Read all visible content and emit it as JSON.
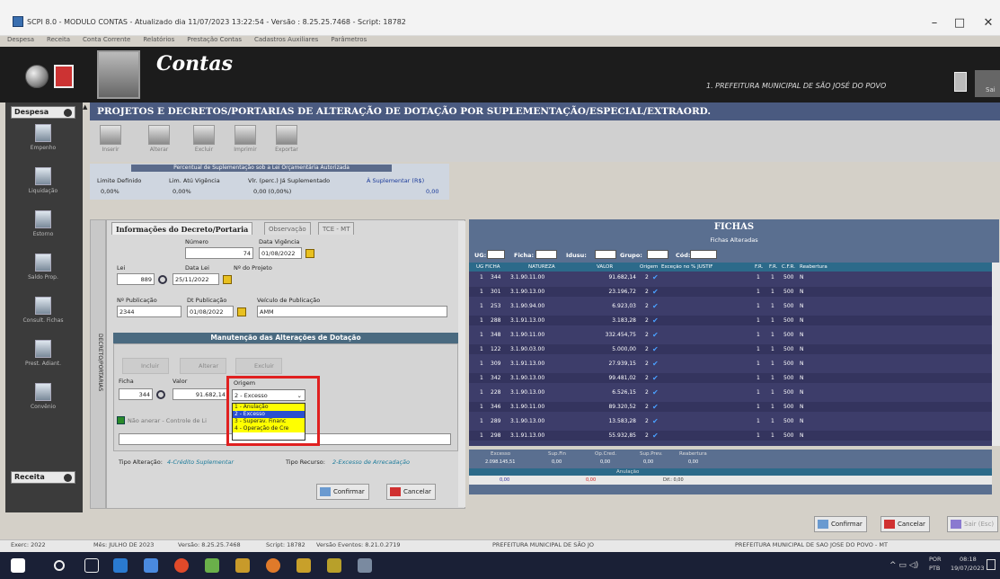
{
  "window": {
    "title": "SCPI 8.0 - MODULO CONTAS - Atualizado dia 11/07/2023 13:22:54 - Versão : 8.25.25.7468 - Script: 18782"
  },
  "menu": [
    "Despesa",
    "Receita",
    "Conta Corrente",
    "Relatórios",
    "Prestação Contas",
    "Cadastros Auxiliares",
    "Parâmetros"
  ],
  "header": {
    "app_name": "Contas",
    "prefeitura": "1. PREFEITURA MUNICIPAL DE SÃO JOSÉ DO POVO",
    "side_label": "Sai"
  },
  "nav": {
    "despesa_label": "Despesa",
    "receita_label": "Receita",
    "items": [
      "Empenho",
      "Liquidação",
      "Estorno",
      "Saldo Prop.",
      "Consult. Fichas",
      "Prest. Adiant.",
      "Convênio"
    ]
  },
  "page_title": "PROJETOS E DECRETOS/PORTARIAS DE ALTERAÇÃO DE DOTAÇÃO POR SUPLEMENTAÇÃO/ESPECIAL/EXTRAORD.",
  "toolbar": {
    "insert": "Inserir",
    "alter": "Alterar",
    "delete": "Excluir",
    "print": "Imprimir",
    "export": "Exportar"
  },
  "stats": {
    "title": "Percentual de Suplementação sob a Lei Orçamentária Autorizada",
    "limit_label": "Limite Definido",
    "limit_value": "0,00%",
    "lim_ativ_label": "Lim. Atú Vigência",
    "lim_ativ_value": "0,00%",
    "vlr_label": "Vlr. (perc.) Já Suplementado",
    "vlr_value": "0,00 (0,00%)",
    "a_sup_label": "À Suplementar (R$)",
    "a_sup_value": "0,00"
  },
  "form": {
    "side_label": "DECRETO/PORTARIAS",
    "tab_info": "Informações do Decreto/Portaria",
    "tab_obs": "Observação",
    "tab_tce": "TCE - MT",
    "numero_label": "Número",
    "numero_value": "74",
    "vigencia_label": "Data Vigência",
    "vigencia_value": "01/08/2022",
    "lei_label": "Lei",
    "lei_value": "889",
    "data_lei_label": "Data Lei",
    "data_lei_value": "25/11/2022",
    "nprojeto_label": "Nº do Projeto",
    "npub_label": "Nº Publicação",
    "npub_value": "2344",
    "dtpub_label": "Dt Publicação",
    "dtpub_value": "01/08/2022",
    "veiculo_label": "Veículo de Publicação",
    "veiculo_value": "AMM",
    "section_title": "Manutenção das Alterações de Dotação",
    "sub_incluir": "Incluir",
    "sub_alterar": "Alterar",
    "sub_excluir": "Excluir",
    "ficha_label": "Ficha",
    "ficha_value": "344",
    "valor_label": "Valor",
    "valor_value": "91.682,14",
    "origem_label": "Origem",
    "origem_selected": "2 - Excesso",
    "origem_options": [
      "1 - Anulação",
      "2 - Excesso",
      "3 - Superav. Financ",
      "4 - Operação de Cre"
    ],
    "checkbox_label": "Não anerar - Controle de Li",
    "tipo_alt_label": "Tipo Alteração:",
    "tipo_alt_value": "4-Crédito Suplementar",
    "tipo_rec_label": "Tipo Recurso:",
    "tipo_rec_value": "2-Excesso de Arrecadação",
    "confirm": "Confirmar",
    "cancel": "Cancelar"
  },
  "fichas": {
    "title": "FICHAS",
    "subtitle": "Fichas Alteradas",
    "filters": [
      "UG:",
      "Ficha:",
      "Idusu:",
      "Grupo:",
      "Cód:"
    ],
    "columns": [
      "UG",
      "FICHA",
      "NATUREZA",
      "VALOR",
      "Origem",
      "Exceção no % JUSTIF",
      "F.R.",
      "F.R.",
      "C.F.R.",
      "Reabertura"
    ],
    "rows": [
      {
        "ug": "1",
        "ficha": "344",
        "natureza": "3.1.90.11.00",
        "valor": "91.682,14",
        "origem": "2",
        "fr1": "1",
        "fr2": "1",
        "cfr": "500",
        "reab": "N"
      },
      {
        "ug": "1",
        "ficha": "301",
        "natureza": "3.1.90.13.00",
        "valor": "23.196,72",
        "origem": "2",
        "fr1": "1",
        "fr2": "1",
        "cfr": "500",
        "reab": "N"
      },
      {
        "ug": "1",
        "ficha": "253",
        "natureza": "3.1.90.94.00",
        "valor": "6.923,03",
        "origem": "2",
        "fr1": "1",
        "fr2": "1",
        "cfr": "500",
        "reab": "N"
      },
      {
        "ug": "1",
        "ficha": "288",
        "natureza": "3.1.91.13.00",
        "valor": "3.183,28",
        "origem": "2",
        "fr1": "1",
        "fr2": "1",
        "cfr": "500",
        "reab": "N"
      },
      {
        "ug": "1",
        "ficha": "348",
        "natureza": "3.1.90.11.00",
        "valor": "332.454,75",
        "origem": "2",
        "fr1": "1",
        "fr2": "1",
        "cfr": "500",
        "reab": "N"
      },
      {
        "ug": "1",
        "ficha": "122",
        "natureza": "3.1.90.03.00",
        "valor": "5.000,00",
        "origem": "2",
        "fr1": "1",
        "fr2": "1",
        "cfr": "500",
        "reab": "N"
      },
      {
        "ug": "1",
        "ficha": "309",
        "natureza": "3.1.91.13.00",
        "valor": "27.939,15",
        "origem": "2",
        "fr1": "1",
        "fr2": "1",
        "cfr": "500",
        "reab": "N"
      },
      {
        "ug": "1",
        "ficha": "342",
        "natureza": "3.1.90.13.00",
        "valor": "99.481,02",
        "origem": "2",
        "fr1": "1",
        "fr2": "1",
        "cfr": "500",
        "reab": "N"
      },
      {
        "ug": "1",
        "ficha": "228",
        "natureza": "3.1.90.13.00",
        "valor": "6.526,15",
        "origem": "2",
        "fr1": "1",
        "fr2": "1",
        "cfr": "500",
        "reab": "N"
      },
      {
        "ug": "1",
        "ficha": "346",
        "natureza": "3.1.90.11.00",
        "valor": "89.320,52",
        "origem": "2",
        "fr1": "1",
        "fr2": "1",
        "cfr": "500",
        "reab": "N"
      },
      {
        "ug": "1",
        "ficha": "289",
        "natureza": "3.1.90.13.00",
        "valor": "13.583,28",
        "origem": "2",
        "fr1": "1",
        "fr2": "1",
        "cfr": "500",
        "reab": "N"
      },
      {
        "ug": "1",
        "ficha": "298",
        "natureza": "3.1.91.13.00",
        "valor": "55.932,85",
        "origem": "2",
        "fr1": "1",
        "fr2": "1",
        "cfr": "500",
        "reab": "N"
      }
    ],
    "totals": {
      "excesso_label": "Excesso",
      "excesso_value": "2.098.145,51",
      "sup_fin_label": "Sup.Fin",
      "sup_fin_value": "0,00",
      "op_cred_label": "Op.Cred.",
      "op_cred_value": "0,00",
      "sup_prev_label": "Sup.Prev.",
      "sup_prev_value": "0,00",
      "reab_label": "Reabertura",
      "reab_value": "0,00",
      "anulacao_label": "Anulação",
      "anulacao_value": "0,00",
      "anul_left": "0,00",
      "dif_label": "Dif.: 0,00"
    }
  },
  "bottom": {
    "confirm": "Confirmar",
    "cancel": "Cancelar",
    "exit": "Sair (Esc)"
  },
  "status": {
    "exercicio": "Exerc: 2022",
    "mes": "Mês: JULHO DE 2023",
    "versao": "Versão: 8.25.25.7468",
    "script": "Script: 18782",
    "versao_eventos": "Versão Eventos: 8.21.0.2719",
    "pref_left": "PREFEITURA MUNICIPAL DE SÃO JO",
    "pref_right": "PREFEITURA MUNICIPAL DE SAO JOSE DO POVO - MT"
  },
  "taskbar": {
    "lang": "POR",
    "lang2": "PTB",
    "time": "08:18",
    "date": "19/07/2023"
  },
  "colors": {
    "red_highlight": "#e02020",
    "dark_blue": "#3d3d6a",
    "header_blue": "#5a6f90",
    "title_blue": "#4a5a80",
    "opt_yellow": "#ffff00",
    "opt_selected": "#2a4fd0"
  }
}
